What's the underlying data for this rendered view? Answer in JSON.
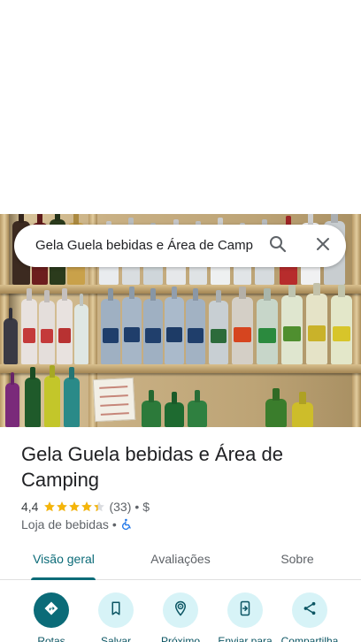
{
  "search": {
    "query": "Gela Guela bebidas e Área de Camp",
    "search_icon": "search-icon",
    "close_icon": "close-icon"
  },
  "place": {
    "name": "Gela Guela bebidas e Área de Camping",
    "rating": "4,4",
    "rating_value": 4.4,
    "reviews_count": "(33)",
    "price_sep": "•",
    "price": "$",
    "category": "Loja de bebidas",
    "category_sep": "•",
    "accessibility_icon": "wheelchair-icon"
  },
  "tabs": [
    {
      "label": "Visão geral",
      "active": true
    },
    {
      "label": "Avaliações",
      "active": false
    },
    {
      "label": "Sobre",
      "active": false
    }
  ],
  "actions": [
    {
      "label": "Rotas",
      "icon": "directions-icon"
    },
    {
      "label": "Salvar",
      "icon": "bookmark-icon"
    },
    {
      "label": "Próximo",
      "icon": "nearby-icon"
    },
    {
      "label": "Enviar para",
      "icon": "send-to-phone-icon"
    },
    {
      "label": "Compartilha",
      "icon": "share-icon"
    }
  ],
  "colors": {
    "accent": "#0b6b78",
    "accent_light": "#d7f3f7",
    "star": "#f5b50a",
    "text": "#202124",
    "muted": "#5f6368"
  }
}
